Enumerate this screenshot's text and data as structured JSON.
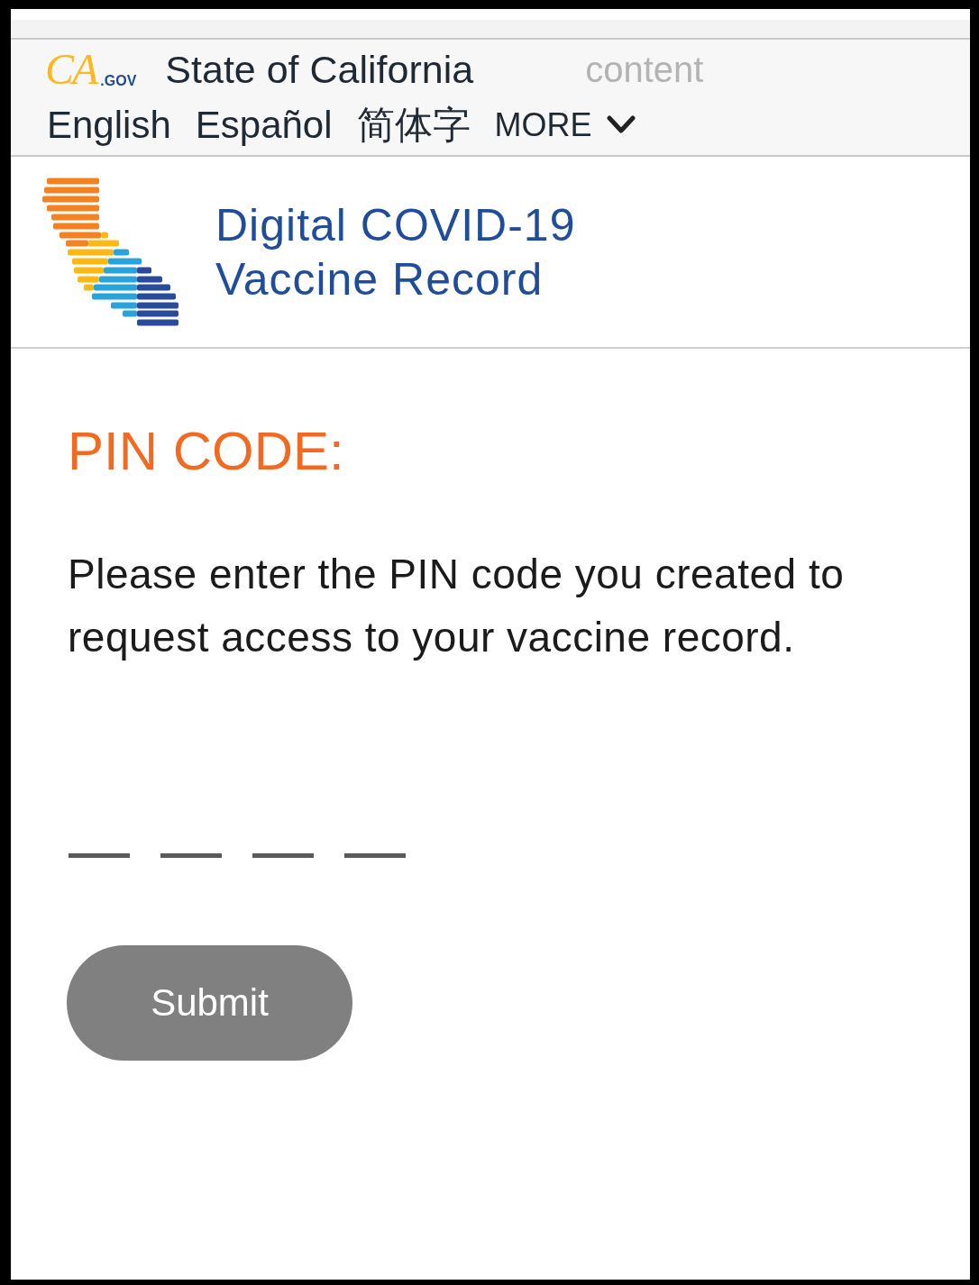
{
  "top_bar": {
    "logo": {
      "mark": "CA",
      "suffix": ".GOV"
    },
    "title": "State of California",
    "skip_link": "content",
    "languages": [
      {
        "label": "English"
      },
      {
        "label": "Español"
      },
      {
        "label": "简体字"
      }
    ],
    "more": {
      "label": "MORE",
      "expanded": false
    }
  },
  "brand": {
    "title": "Digital COVID-19 Vaccine Record"
  },
  "form": {
    "heading": "PIN CODE:",
    "instructions": "Please enter the PIN code you created to request access to your vaccine record.",
    "pin_fields": [
      {
        "kind": "digit"
      },
      {
        "kind": "digit"
      },
      {
        "kind": "digit"
      },
      {
        "kind": "digit"
      }
    ],
    "submit": {
      "label": "Submit",
      "disabled": true
    }
  }
}
